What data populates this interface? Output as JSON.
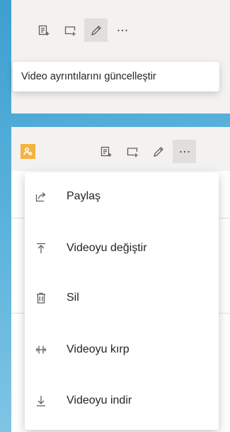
{
  "top_panel": {
    "toolbar": [
      {
        "icon": "edit-notes-icon"
      },
      {
        "icon": "add-frame-icon"
      },
      {
        "icon": "pencil-icon"
      },
      {
        "icon": "more-options-icon",
        "label": "..."
      }
    ],
    "tooltip": "Video ayrıntılarını güncelleştir"
  },
  "bottom_panel": {
    "badge_icon": "people-icon",
    "badge_color": "#f4b33f",
    "toolbar": [
      {
        "icon": "edit-notes-icon"
      },
      {
        "icon": "add-frame-icon"
      },
      {
        "icon": "pencil-icon"
      },
      {
        "icon": "more-options-icon",
        "label": "..."
      }
    ],
    "menu": {
      "items": [
        {
          "icon": "share-icon",
          "label": "Paylaş"
        },
        {
          "icon": "upload-icon",
          "label": "Videoyu değiştir"
        },
        {
          "icon": "trash-icon",
          "label": "Sil"
        },
        {
          "icon": "trim-icon",
          "label": "Videoyu kırp"
        },
        {
          "icon": "download-icon",
          "label": "Videoyu indir"
        }
      ]
    }
  },
  "colors": {
    "background": "#5cb3dc",
    "panel": "#f3f2f1",
    "active_button": "#e1dfdd",
    "text": "#252423",
    "icon": "#605e5c"
  }
}
